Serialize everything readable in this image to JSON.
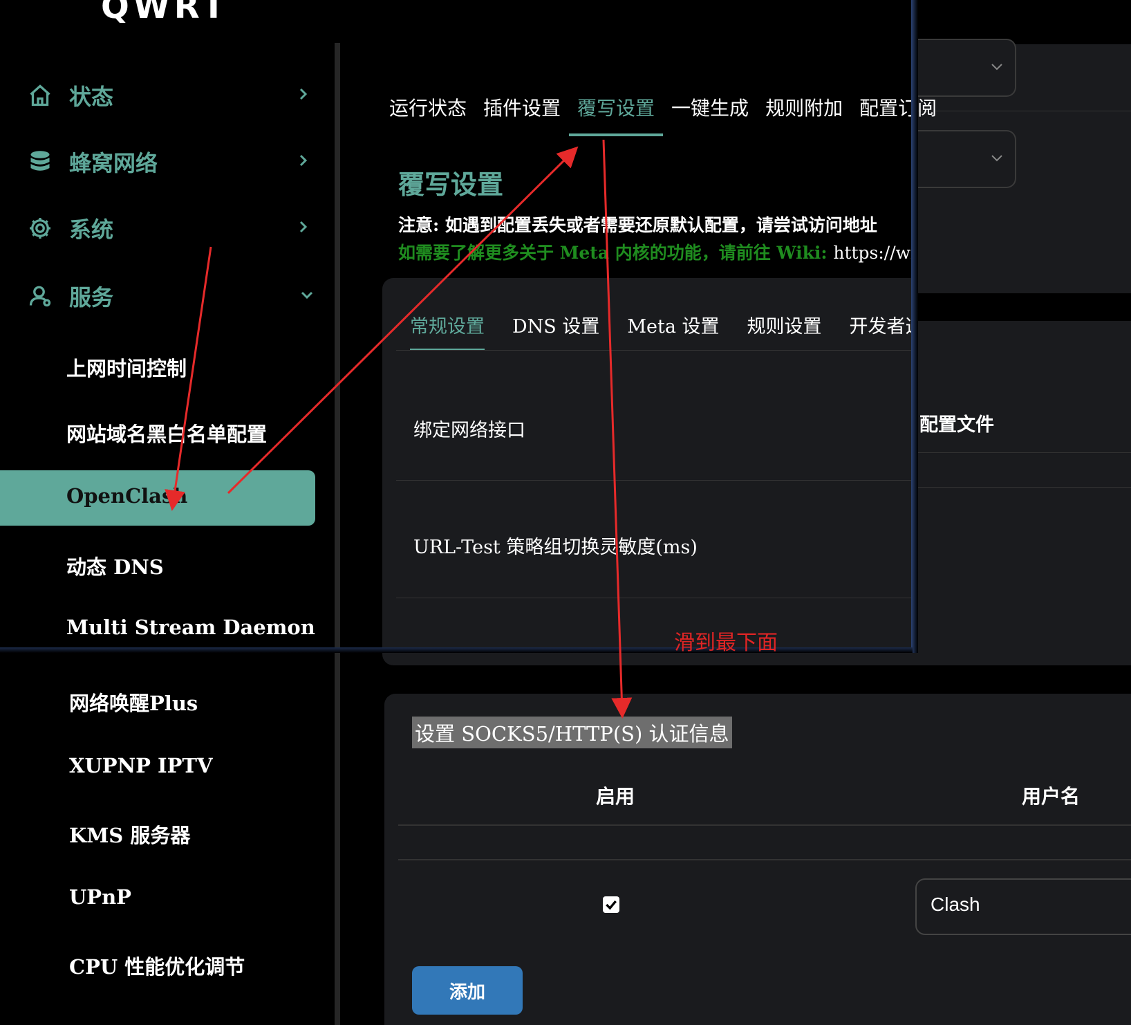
{
  "app": {
    "logo": "QWRT"
  },
  "sidebar": {
    "top_items": [
      {
        "label": "状态",
        "icon": "home-icon"
      },
      {
        "label": "蜂窝网络",
        "icon": "database-icon"
      },
      {
        "label": "系统",
        "icon": "gear-icon"
      },
      {
        "label": "服务",
        "icon": "user-icon"
      }
    ],
    "service_items": [
      "上网时间控制",
      "网站域名黑白名单配置",
      "OpenClash",
      "动态 DNS",
      "Multi Stream Daemon",
      "网络唤醒Plus",
      "XUPNP IPTV",
      "KMS 服务器",
      "UPnP",
      "CPU 性能优化调节"
    ],
    "active_item": "OpenClash"
  },
  "main": {
    "tabs": [
      "运行状态",
      "插件设置",
      "覆写设置",
      "一键生成",
      "规则附加",
      "配置订阅"
    ],
    "active_tab": "覆写设置",
    "section_title": "覆写设置",
    "note_line1": "注意: 如遇到配置丢失或者需要还原默认配置，请尝试访问地址",
    "note_line2": "如需要了解更多关于 Meta 内核的功能，请前往 Wiki:",
    "note_url": "https://wi",
    "sub_tabs": [
      "常规设置",
      "DNS 设置",
      "Meta 设置",
      "规则设置",
      "开发者选项"
    ],
    "active_sub_tab": "常规设置",
    "fields": [
      "绑定网络接口",
      "URL-Test 策略组切换灵敏度(ms)"
    ],
    "bg_label": "配置文件"
  },
  "annotation": {
    "text": "滑到最下面",
    "color": "#e02525"
  },
  "auth": {
    "title": "设置 SOCKS5/HTTP(S) 认证信息",
    "col_enable": "启用",
    "col_username": "用户名",
    "row": {
      "enabled": true,
      "username": "Clash"
    },
    "add_button": "添加"
  },
  "colors": {
    "accent": "#5fa89a",
    "green_note": "#1f8c1f",
    "button": "#3278b8"
  }
}
